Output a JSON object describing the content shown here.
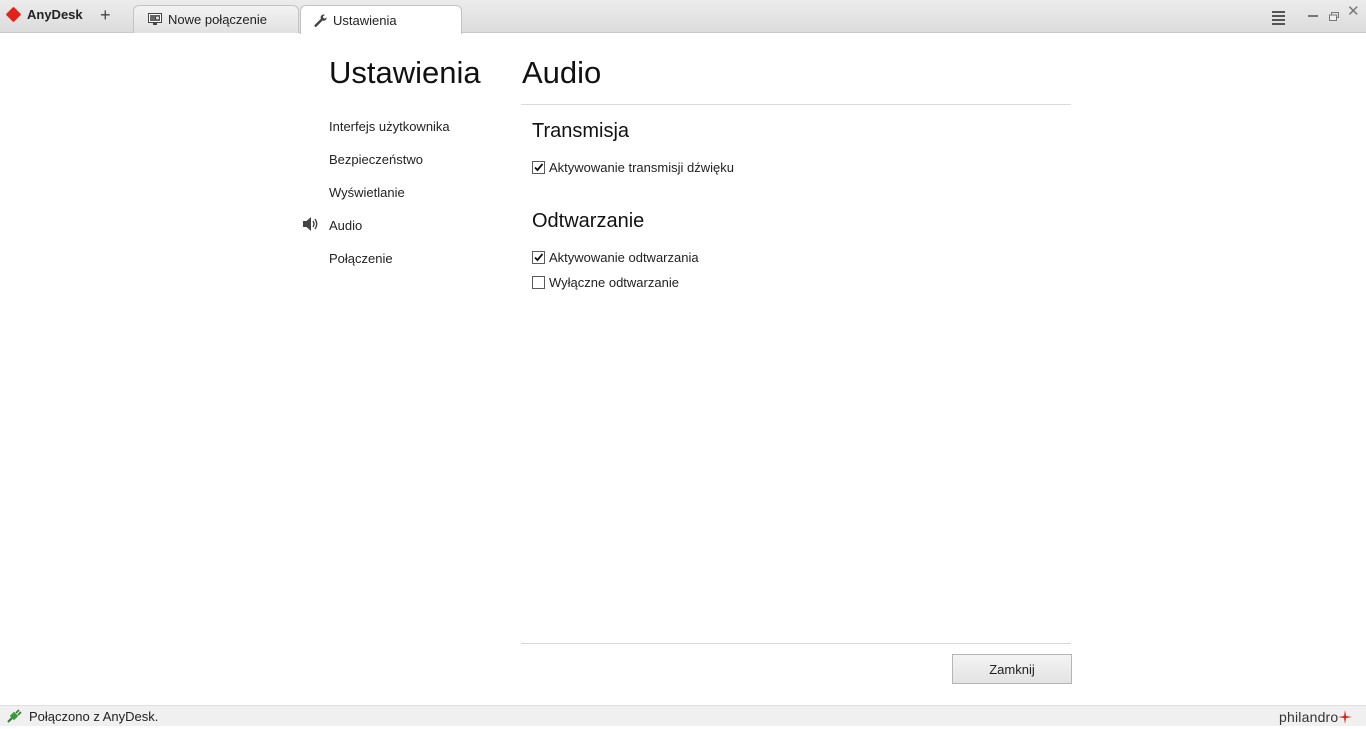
{
  "app": {
    "name": "AnyDesk",
    "accent_color": "#e2231a"
  },
  "tabs": [
    {
      "label": "Nowe połączenie",
      "icon": "monitor-icon",
      "active": false
    },
    {
      "label": "Ustawienia",
      "icon": "wrench-icon",
      "active": true
    }
  ],
  "settings": {
    "title": "Ustawienia",
    "nav": [
      {
        "label": "Interfejs użytkownika",
        "selected": false
      },
      {
        "label": "Bezpieczeństwo",
        "selected": false
      },
      {
        "label": "Wyświetlanie",
        "selected": false
      },
      {
        "label": "Audio",
        "selected": true,
        "icon": "speaker-icon"
      },
      {
        "label": "Połączenie",
        "selected": false
      }
    ]
  },
  "audio": {
    "title": "Audio",
    "transmisja": {
      "title": "Transmisja",
      "options": [
        {
          "label": "Aktywowanie transmisji dźwięku",
          "checked": true
        }
      ]
    },
    "odtwarzanie": {
      "title": "Odtwarzanie",
      "options": [
        {
          "label": "Aktywowanie odtwarzania",
          "checked": true
        },
        {
          "label": "Wyłączne odtwarzanie",
          "checked": false
        }
      ]
    },
    "close_button": "Zamknij"
  },
  "status": {
    "text": "Połączono z AnyDesk.",
    "icon": "connected-plug-icon",
    "icon_color": "#3a9a3a",
    "brand": "philandro"
  }
}
